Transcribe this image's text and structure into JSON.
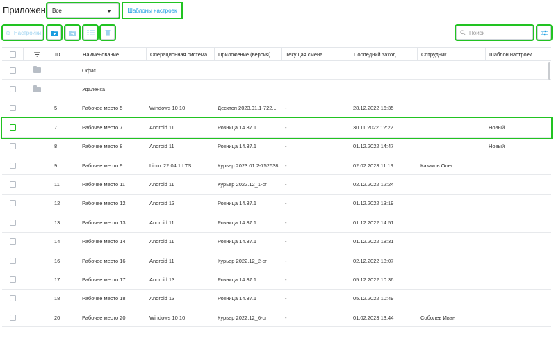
{
  "header": {
    "app_label": "Приложение",
    "app_select_value": "Все",
    "templates_button": "Шаблоны настроек"
  },
  "toolbar": {
    "settings_label": "Настройки",
    "search_placeholder": "Поиск",
    "icons": [
      "gear-icon",
      "add-folder-icon",
      "move-to-folder-icon",
      "list-icon",
      "trash-icon",
      "search-icon",
      "filter-settings-icon"
    ]
  },
  "table": {
    "columns": [
      "",
      "",
      "ID",
      "Наименование",
      "Операционная система",
      "Приложение (версия)",
      "Текущая смена",
      "Последний заход",
      "Сотрудник",
      "Шаблон настроек"
    ],
    "folders": [
      {
        "name": "Офис"
      },
      {
        "name": "Удаленка"
      }
    ],
    "rows": [
      {
        "id": "5",
        "name": "Рабочее место 5",
        "os": "Windows 10 10",
        "app": "Десктоп 2023.01.1-722...",
        "shift": "-",
        "last": "28.12.2022 16:35",
        "employee": "",
        "template": ""
      },
      {
        "id": "7",
        "name": "Рабочее место 7",
        "os": "Android 11",
        "app": "Розница 14.37.1",
        "shift": "-",
        "last": "30.11.2022 12:22",
        "employee": "",
        "template": "Новый"
      },
      {
        "id": "8",
        "name": "Рабочее место 8",
        "os": "Android 11",
        "app": "Розница 14.37.1",
        "shift": "-",
        "last": "01.12.2022 14:47",
        "employee": "",
        "template": "Новый"
      },
      {
        "id": "9",
        "name": "Рабочее место 9",
        "os": "Linux 22.04.1 LTS",
        "app": "Курьер 2023.01.2-752638",
        "shift": "-",
        "last": "02.02.2023 11:19",
        "employee": "Казаков Олег",
        "template": ""
      },
      {
        "id": "11",
        "name": "Рабочее место 11",
        "os": "Android 11",
        "app": "Курьер 2022.12_1-cr",
        "shift": "-",
        "last": "02.12.2022 12:24",
        "employee": "",
        "template": ""
      },
      {
        "id": "12",
        "name": "Рабочее место 12",
        "os": "Android 13",
        "app": "Розница 14.37.1",
        "shift": "-",
        "last": "01.12.2022 13:19",
        "employee": "",
        "template": ""
      },
      {
        "id": "13",
        "name": "Рабочее место 13",
        "os": "Android 11",
        "app": "Розница 14.37.1",
        "shift": "-",
        "last": "01.12.2022 14:51",
        "employee": "",
        "template": ""
      },
      {
        "id": "14",
        "name": "Рабочее место 14",
        "os": "Android 11",
        "app": "Розница 14.37.1",
        "shift": "-",
        "last": "01.12.2022 18:31",
        "employee": "",
        "template": ""
      },
      {
        "id": "16",
        "name": "Рабочее место 16",
        "os": "Android 11",
        "app": "Курьер 2022.12_2-cr",
        "shift": "-",
        "last": "02.12.2022 18:07",
        "employee": "",
        "template": ""
      },
      {
        "id": "17",
        "name": "Рабочее место 17",
        "os": "Android 13",
        "app": "Розница 14.37.1",
        "shift": "-",
        "last": "05.12.2022 10:36",
        "employee": "",
        "template": ""
      },
      {
        "id": "18",
        "name": "Рабочее место 18",
        "os": "Android 13",
        "app": "Розница 14.37.1",
        "shift": "-",
        "last": "05.12.2022 10:49",
        "employee": "",
        "template": ""
      },
      {
        "id": "20",
        "name": "Рабочее место 20",
        "os": "Windows 10 10",
        "app": "Курьер 2022.12_6-cr",
        "shift": "-",
        "last": "01.02.2023 13:44",
        "employee": "Соболев Иван",
        "template": ""
      }
    ],
    "highlighted_row_id": "7"
  },
  "colors": {
    "accent": "#1a9de0",
    "highlight": "#22c322",
    "icon_gray": "#b8bec6"
  }
}
